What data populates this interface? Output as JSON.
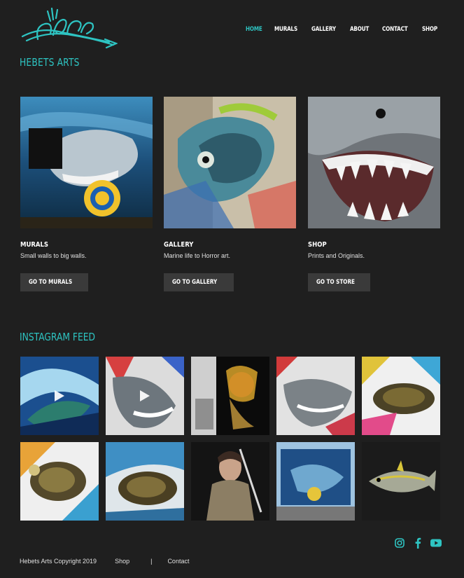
{
  "brand": {
    "logo_text": "HEBS",
    "site_title": "HEBETS ARTS",
    "accent_color": "#2ec4c2"
  },
  "nav": {
    "items": [
      {
        "label": "HOME",
        "active": true
      },
      {
        "label": "MURALS",
        "active": false
      },
      {
        "label": "GALLERY",
        "active": false
      },
      {
        "label": "ABOUT",
        "active": false
      },
      {
        "label": "CONTACT",
        "active": false
      },
      {
        "label": "SHOP",
        "active": false
      }
    ]
  },
  "cards": [
    {
      "title": "MURALS",
      "description": "Small walls to big walls.",
      "button": "GO TO MURALS",
      "image": "shark-mural-on-building"
    },
    {
      "title": "GALLERY",
      "description": "Marine life to Horror art.",
      "button": "GO TO GALLERY",
      "image": "mahi-mahi-fish-mural"
    },
    {
      "title": "SHOP",
      "description": "Prints and Originals.",
      "button": "GO TO STORE",
      "image": "great-white-shark-jaws-painting"
    }
  ],
  "instagram": {
    "title": "INSTAGRAM FEED",
    "posts": [
      {
        "image": "mahi-mahi-wave-painting",
        "video": true
      },
      {
        "image": "shark-painting",
        "video": true
      },
      {
        "image": "horror-character-painting",
        "video": false
      },
      {
        "image": "shark-mural-closeup",
        "video": false
      },
      {
        "image": "sea-turtle-colorful",
        "video": false
      },
      {
        "image": "sea-turtle-canvas",
        "video": false
      },
      {
        "image": "sea-turtle-wave",
        "video": false
      },
      {
        "image": "girl-with-sword-painting",
        "video": false
      },
      {
        "image": "shark-mural-building",
        "video": false
      },
      {
        "image": "yellowfin-tuna-painting",
        "video": false
      }
    ]
  },
  "social": {
    "icons": [
      "instagram-icon",
      "facebook-icon",
      "youtube-icon"
    ]
  },
  "footer": {
    "copyright": "Hebets Arts Copyright 2019",
    "links": [
      "Shop",
      "Contact"
    ],
    "separator": "|"
  }
}
